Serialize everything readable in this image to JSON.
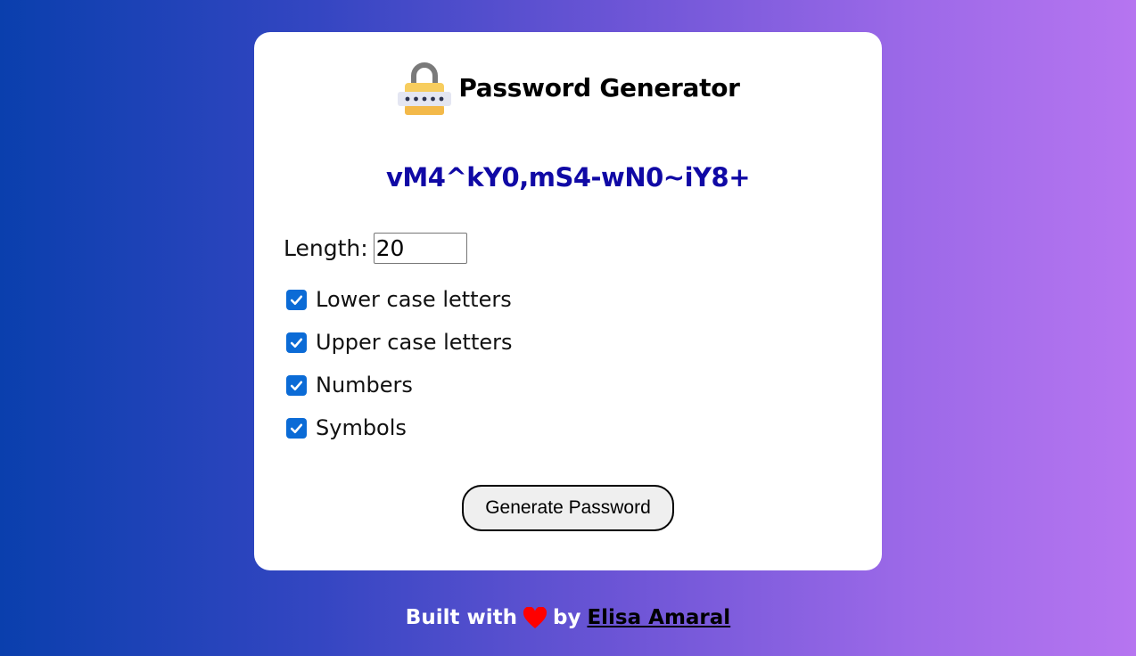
{
  "app": {
    "title": "Password Generator",
    "icon": "padlock-icon"
  },
  "password": {
    "value": "vM4^kY0,mS4-wN0~iY8+"
  },
  "length": {
    "label": "Length:",
    "value": "20"
  },
  "options": [
    {
      "label": "Lower case letters",
      "checked": true
    },
    {
      "label": "Upper case letters",
      "checked": true
    },
    {
      "label": "Numbers",
      "checked": true
    },
    {
      "label": "Symbols",
      "checked": true
    }
  ],
  "generate_button": {
    "label": "Generate Password"
  },
  "footer": {
    "prefix": "Built with",
    "icon": "heart-icon",
    "by": "by",
    "author": "Elisa Amaral"
  },
  "colors": {
    "password_text": "#1009a5",
    "checkbox": "#0b6bd6",
    "heart": "#ff0000",
    "gradient_start": "#0a3fad",
    "gradient_end": "#b675f0"
  }
}
